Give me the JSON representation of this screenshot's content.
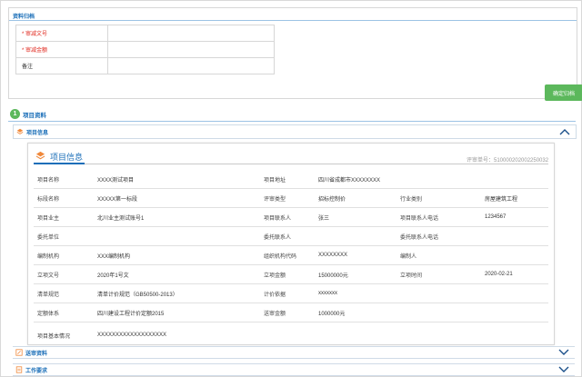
{
  "archive": {
    "title": "资料归档",
    "fields": [
      {
        "required": "*",
        "label": "审减文号",
        "value": ""
      },
      {
        "required": "*",
        "label": "审减金额",
        "value": ""
      },
      {
        "required": "",
        "label": "备注",
        "value": ""
      }
    ],
    "confirm_label": "确定归档"
  },
  "project_section": {
    "step": "1",
    "title": "项目资料"
  },
  "project_info_header": {
    "title": "项目信息"
  },
  "info_panel": {
    "title": "项目信息",
    "review_number": "评审单号：510000202002250032",
    "rows": [
      [
        "项目名称",
        "XXXX测试项目",
        "项目地址",
        "四川省成都市XXXXXXXX",
        "",
        ""
      ],
      [
        "标段名称",
        "XXXXX第一标段",
        "评审类型",
        "招标控制价",
        "行业类别",
        "房屋建筑工程"
      ],
      [
        "项目业主",
        "北川业主测试账号1",
        "项目联系人",
        "张三",
        "项目联系人电话",
        "1234567"
      ],
      [
        "委托单位",
        "",
        "委托联系人",
        "",
        "委托联系人电话",
        ""
      ],
      [
        "编制机构",
        "XXX编制机构",
        "组织机构代码",
        "XXXXXXXX",
        "编制人",
        ""
      ],
      [
        "立项文号",
        "2020年1号文",
        "立项金额",
        "15000000元",
        "立项时间",
        "2020-02-21"
      ],
      [
        "清单规范",
        "清单计价规范（GB50500-2013）",
        "计价依据",
        "xxxxxxx",
        "",
        ""
      ],
      [
        "定额体系",
        "四川建设工程计价定额2015",
        "送审金额",
        "1000000元",
        "",
        ""
      ]
    ],
    "summary_label": "项目基本情况",
    "summary_value": "XXXXXXXXXXXXXXXXXXX"
  },
  "bottom_sections": [
    {
      "title": "送审资料"
    },
    {
      "title": "工作要求"
    }
  ],
  "colors": {
    "accent": "#1a6eb8",
    "button": "#5cb85c",
    "required": "#e0251b",
    "orange_icon": "#f0883a"
  }
}
